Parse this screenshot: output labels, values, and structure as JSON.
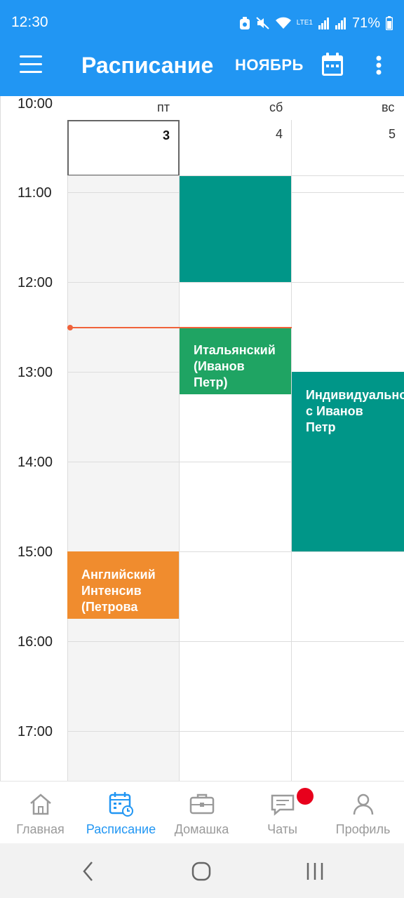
{
  "status_bar": {
    "time": "12:30",
    "network": "LTE1",
    "battery": "71%",
    "icons": [
      "recycle-icon",
      "mute-icon",
      "wifi-icon",
      "signal-icon",
      "signal-r-icon",
      "battery-icon"
    ]
  },
  "app_bar": {
    "title": "Расписание",
    "month": "НОЯБРЬ",
    "menu_icon": "hamburger-menu-icon",
    "calendar_icon": "calendar-icon",
    "more_icon": "more-vertical-icon"
  },
  "calendar": {
    "days": [
      {
        "name": "пт",
        "number": "3",
        "today": true
      },
      {
        "name": "сб",
        "number": "4",
        "today": false
      },
      {
        "name": "вс",
        "number": "5",
        "today": false
      }
    ],
    "hours": [
      "10:00",
      "11:00",
      "12:00",
      "13:00",
      "14:00",
      "15:00",
      "16:00",
      "17:00"
    ],
    "current_time": "12:30",
    "events": [
      {
        "day": "сб",
        "start": "11:00",
        "end": "12:00",
        "title": "",
        "color": "#009688"
      },
      {
        "day": "сб",
        "start": "12:30",
        "end": "13:15",
        "title": "Итальянский (Иванов Петр)",
        "color": "#1fa463"
      },
      {
        "day": "вс",
        "start": "13:00",
        "end": "15:00",
        "title": "Индивидуально с Иванов Петр",
        "color": "#009688"
      },
      {
        "day": "пт",
        "start": "15:00",
        "end": "15:45",
        "title": "Английский Интенсив (Петрова",
        "color": "#f08c2e"
      }
    ]
  },
  "bottom_nav": {
    "items": [
      {
        "label": "Главная",
        "icon": "home-icon",
        "active": false
      },
      {
        "label": "Расписание",
        "icon": "schedule-calendar-icon",
        "active": true
      },
      {
        "label": "Домашка",
        "icon": "briefcase-icon",
        "active": false
      },
      {
        "label": "Чаты",
        "icon": "chat-icon",
        "active": false,
        "badge": true
      },
      {
        "label": "Профиль",
        "icon": "profile-icon",
        "active": false
      }
    ]
  },
  "system_nav": {
    "buttons": [
      "back-icon",
      "home-circle-icon",
      "recents-icon"
    ]
  },
  "colors": {
    "primary": "#2196f3",
    "today_column": "#f4f4f4",
    "now_line": "#f0623a",
    "badge": "#e8001c"
  }
}
